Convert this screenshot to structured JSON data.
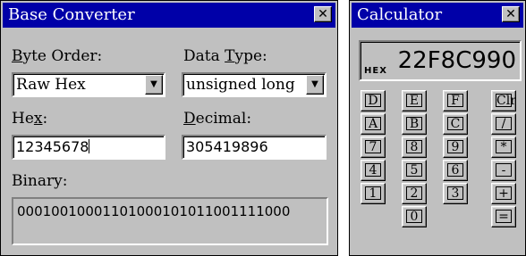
{
  "base_converter": {
    "title": "Base Converter",
    "close_glyph": "✕",
    "byte_order_label": "Byte Order:",
    "byte_order_value": "Raw Hex",
    "data_type_label": "Data Type:",
    "data_type_value": "unsigned long",
    "hex_label": "Hex:",
    "hex_value": "12345678",
    "decimal_label": "Decimal:",
    "decimal_value": "305419896",
    "binary_label": "Binary:",
    "binary_value": "00010010001101000101011001111000",
    "dropdown_glyph": "▼"
  },
  "calculator": {
    "title": "Calculator",
    "close_glyph": "✕",
    "mode_label": "HEX",
    "display_value": "22F8C990",
    "keys": [
      [
        "D",
        "E",
        "F",
        "Clr"
      ],
      [
        "A",
        "B",
        "C",
        "/"
      ],
      [
        "7",
        "8",
        "9",
        "*"
      ],
      [
        "4",
        "5",
        "6",
        "-"
      ],
      [
        "1",
        "2",
        "3",
        "+"
      ],
      [
        "",
        "0",
        "",
        "="
      ]
    ]
  }
}
